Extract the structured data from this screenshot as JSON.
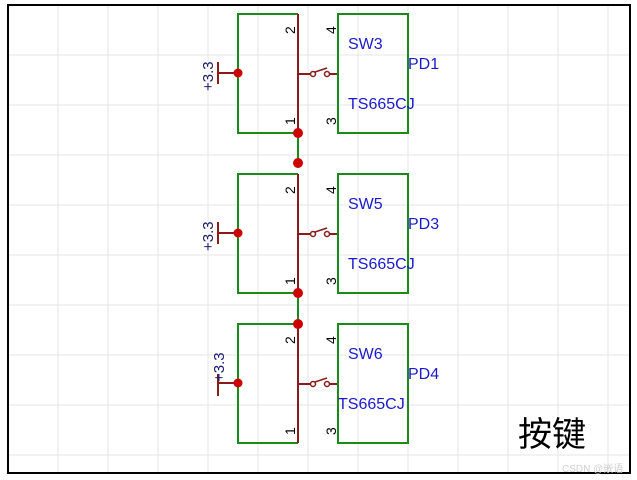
{
  "colors": {
    "grid": "#e6e6e6",
    "frame": "#000000",
    "wire": "#1a8a1a",
    "pin": "#8b1a1a",
    "junction": "#cc0000",
    "ref_text": "#1a1acc",
    "power_text": "#1a1a6e",
    "pin_number": "#000000"
  },
  "title": "按键",
  "watermark": "CSDN @嵌语",
  "switches": [
    {
      "designator": "SW3",
      "part": "TS665CJ",
      "net": "PD1",
      "power": "+3.3",
      "pins": [
        "2",
        "1",
        "4",
        "3"
      ]
    },
    {
      "designator": "SW5",
      "part": "TS665CJ",
      "net": "PD3",
      "power": "+3.3",
      "pins": [
        "2",
        "1",
        "4",
        "3"
      ]
    },
    {
      "designator": "SW6",
      "part": "TS665CJ",
      "net": "PD4",
      "power": "+3.3",
      "pins": [
        "2",
        "1",
        "4",
        "3"
      ]
    }
  ]
}
